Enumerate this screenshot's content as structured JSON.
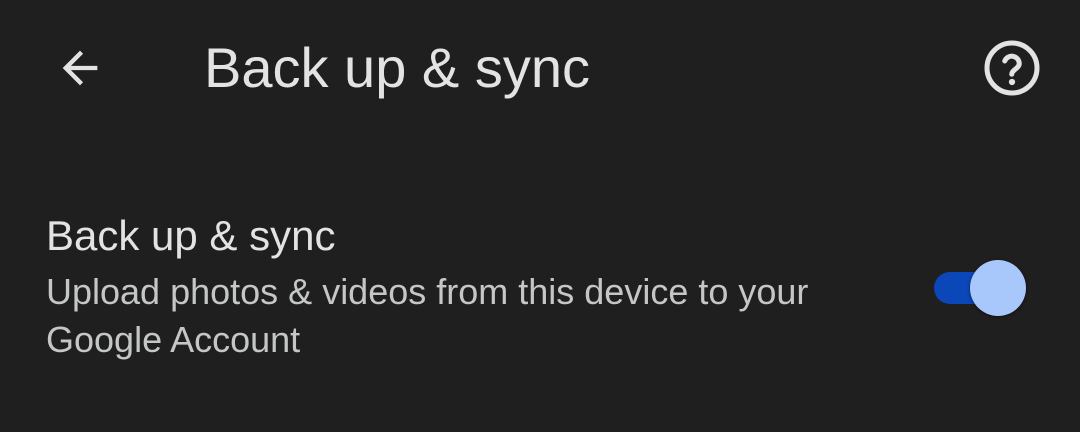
{
  "header": {
    "title": "Back up & sync",
    "back_icon": "arrow-left-icon",
    "help_icon": "help-circle-icon"
  },
  "setting": {
    "title": "Back up & sync",
    "description": "Upload photos & videos from this device to your Google Account",
    "toggle_on": true
  },
  "colors": {
    "background": "#1f1f1f",
    "text_primary": "#e3e3e3",
    "text_secondary": "#c4c7c5",
    "switch_track": "#0b47b8",
    "switch_thumb": "#a8c7fa"
  }
}
